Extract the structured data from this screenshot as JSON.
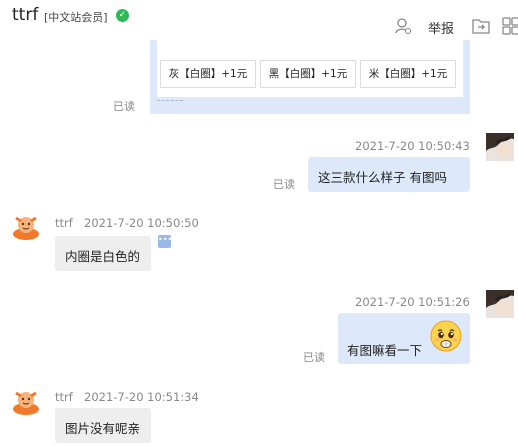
{
  "header": {
    "title": "ttrf",
    "member_badge": "[中文站会员]",
    "verified_icon": "check-circle-icon",
    "report_label": "举报"
  },
  "card": {
    "options": [
      "灰【白圈】+1元",
      "黑【白圈】+1元",
      "米【白圈】+1元"
    ],
    "read_status": "已读"
  },
  "messages": [
    {
      "side": "right",
      "time": "2021-7-20 10:50:43",
      "text": "这三款什么样子   有图吗",
      "read": "已读"
    },
    {
      "side": "left",
      "sender": "ttrf",
      "time": "2021-7-20 10:50:50",
      "text": "内圈是白色的"
    },
    {
      "side": "right",
      "time": "2021-7-20 10:51:26",
      "text": "有图嘛看一下",
      "emoji": "pleading-face-emoji",
      "read": "已读"
    },
    {
      "side": "left",
      "sender": "ttrf",
      "time": "2021-7-20 10:51:34",
      "text": "图片没有呢亲"
    }
  ],
  "colors": {
    "bubble_self": "#dde9fb",
    "bubble_other": "#eeeeee",
    "verified_green": "#2dbb55"
  }
}
